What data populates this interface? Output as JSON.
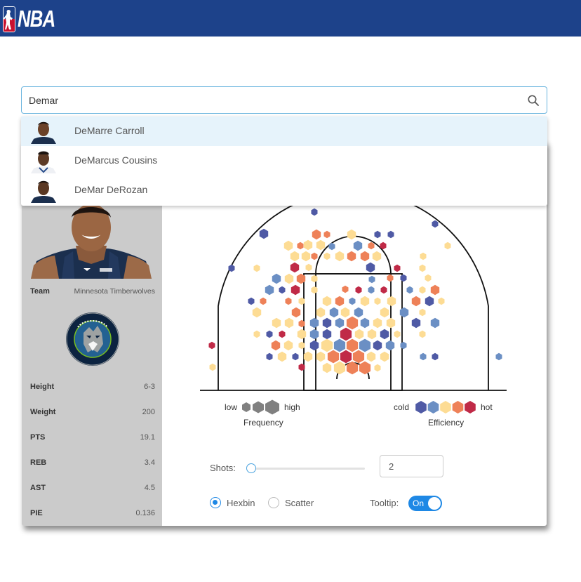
{
  "header": {
    "brand": "NBA"
  },
  "search": {
    "value": "Demar"
  },
  "suggestions": [
    {
      "name": "DeMarre Carroll",
      "selected": true
    },
    {
      "name": "DeMarcus Cousins",
      "selected": false
    },
    {
      "name": "DeMar DeRozan",
      "selected": false
    }
  ],
  "player": {
    "team_label": "Team",
    "team": "Minnesota Timberwolves",
    "stats": [
      {
        "label": "Height",
        "value": "6-3"
      },
      {
        "label": "Weight",
        "value": "200"
      },
      {
        "label": "PTS",
        "value": "19.1"
      },
      {
        "label": "REB",
        "value": "3.4"
      },
      {
        "label": "AST",
        "value": "4.5"
      },
      {
        "label": "PIE",
        "value": "0.136"
      }
    ]
  },
  "legend": {
    "frequency": {
      "low": "low",
      "high": "high",
      "title": "Frequency"
    },
    "efficiency": {
      "cold": "cold",
      "hot": "hot",
      "title": "Efficiency"
    },
    "efficiency_colors": [
      "#4f5aa5",
      "#6b8fc4",
      "#fddc94",
      "#ee8158",
      "#c02a47"
    ],
    "frequency_color": "#808080"
  },
  "controls": {
    "shots_label": "Shots:",
    "shots_value": "2",
    "slider_fraction": 0.0,
    "mode_options": [
      "Hexbin",
      "Scatter"
    ],
    "mode_selected": "Hexbin",
    "tooltip_label": "Tooltip:",
    "tooltip_state": "On"
  }
}
